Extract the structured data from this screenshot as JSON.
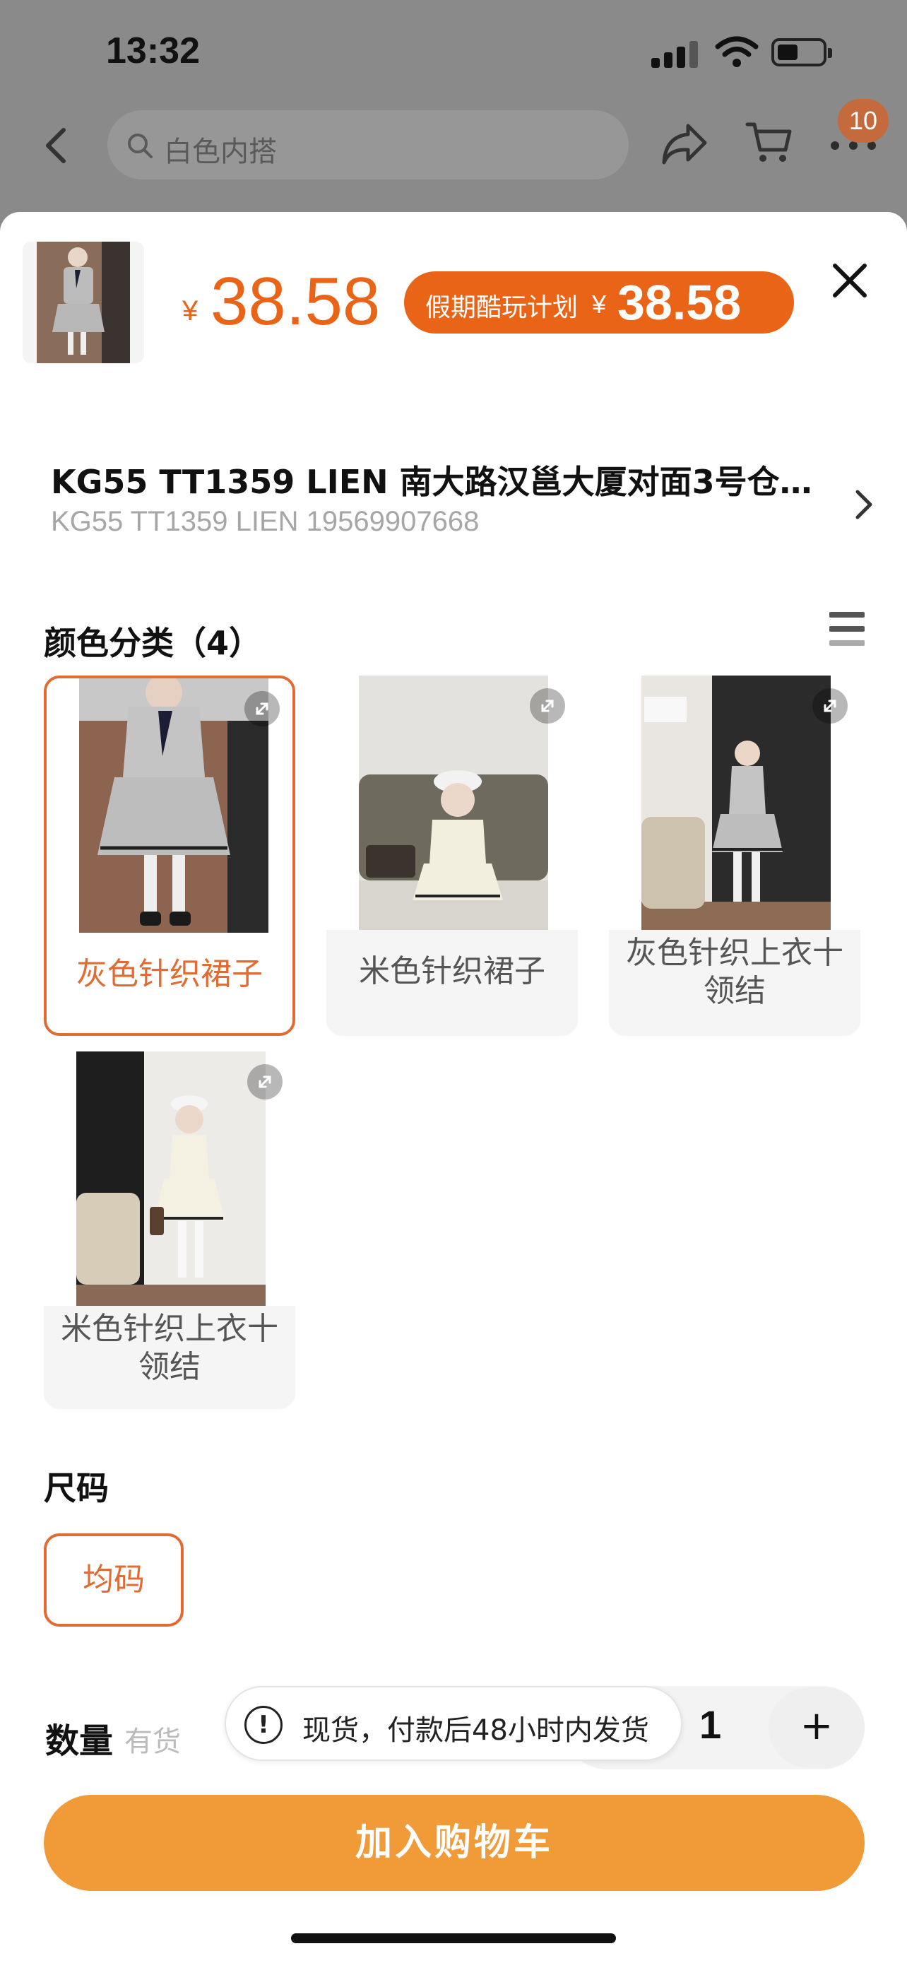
{
  "status_bar": {
    "time": "13:32"
  },
  "top_nav": {
    "search_placeholder": "白色内搭",
    "cart_badge": "10"
  },
  "sheet": {
    "price": {
      "currency": "¥",
      "amount": "38.58"
    },
    "promo": {
      "label": "假期酷玩计划",
      "currency": "¥",
      "amount": "38.58"
    },
    "store": {
      "name": "KG55 TT1359 LIEN  南大路汉邕大厦对面3号仓…",
      "sub": "KG55 TT1359 LIEN 19569907668"
    },
    "color_section": {
      "title": "颜色分类（4）",
      "options": [
        {
          "label": "灰色针织裙子",
          "selected": true
        },
        {
          "label": "米色针织裙子",
          "selected": false
        },
        {
          "label": "灰色针织上衣十\n领结",
          "selected": false
        },
        {
          "label": "米色针织上衣十\n领结",
          "selected": false
        }
      ]
    },
    "size_section": {
      "title": "尺码",
      "options": [
        {
          "label": "均码",
          "selected": true
        }
      ]
    },
    "quantity": {
      "label": "数量",
      "stock": "有货",
      "value": "1",
      "plus": "+"
    },
    "toast": {
      "icon": "!",
      "message": "现货，付款后48小时内发货"
    },
    "add_to_cart": "加入购物车"
  },
  "colors": {
    "accent": "#ea6418",
    "button": "#f19a38",
    "selected_border": "#e06b33"
  }
}
